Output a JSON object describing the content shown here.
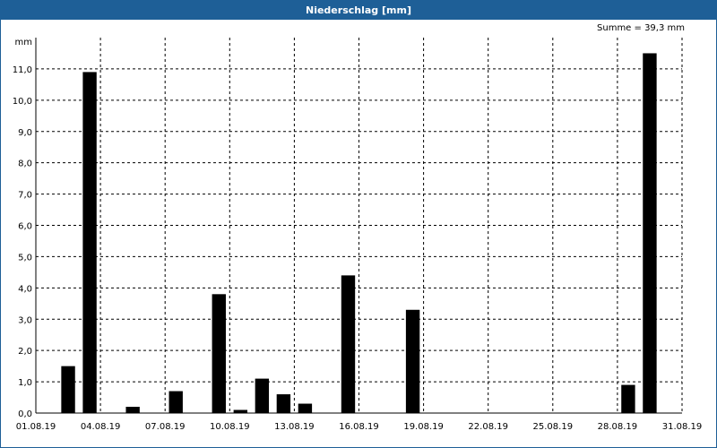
{
  "chart_data": {
    "type": "bar",
    "title": "Niederschlag [mm]",
    "ylabel": "mm",
    "summary": "Summe = 39,3 mm",
    "ylim": [
      0,
      12
    ],
    "grid": true,
    "x_tick_labels": [
      "01.08.19",
      "04.08.19",
      "07.08.19",
      "10.08.19",
      "13.08.19",
      "16.08.19",
      "19.08.19",
      "22.08.19",
      "25.08.19",
      "28.08.19",
      "31.08.19"
    ],
    "y_tick_labels": [
      "0,0",
      "1,0",
      "2,0",
      "3,0",
      "4,0",
      "5,0",
      "6,0",
      "7,0",
      "8,0",
      "9,0",
      "10,0",
      "11,0"
    ],
    "categories": [
      "01.08.19",
      "02.08.19",
      "03.08.19",
      "04.08.19",
      "05.08.19",
      "06.08.19",
      "07.08.19",
      "08.08.19",
      "09.08.19",
      "10.08.19",
      "11.08.19",
      "12.08.19",
      "13.08.19",
      "14.08.19",
      "15.08.19",
      "16.08.19",
      "17.08.19",
      "18.08.19",
      "19.08.19",
      "20.08.19",
      "21.08.19",
      "22.08.19",
      "23.08.19",
      "24.08.19",
      "25.08.19",
      "26.08.19",
      "27.08.19",
      "28.08.19",
      "29.08.19",
      "30.08.19"
    ],
    "values": [
      0,
      1.5,
      10.9,
      0,
      0.2,
      0,
      0.7,
      0,
      3.8,
      0.1,
      1.1,
      0.6,
      0.3,
      0,
      4.4,
      0,
      0,
      3.3,
      0,
      0,
      0,
      0,
      0,
      0,
      0,
      0,
      0,
      0.9,
      11.5,
      0
    ],
    "bar_color": "#000000"
  }
}
